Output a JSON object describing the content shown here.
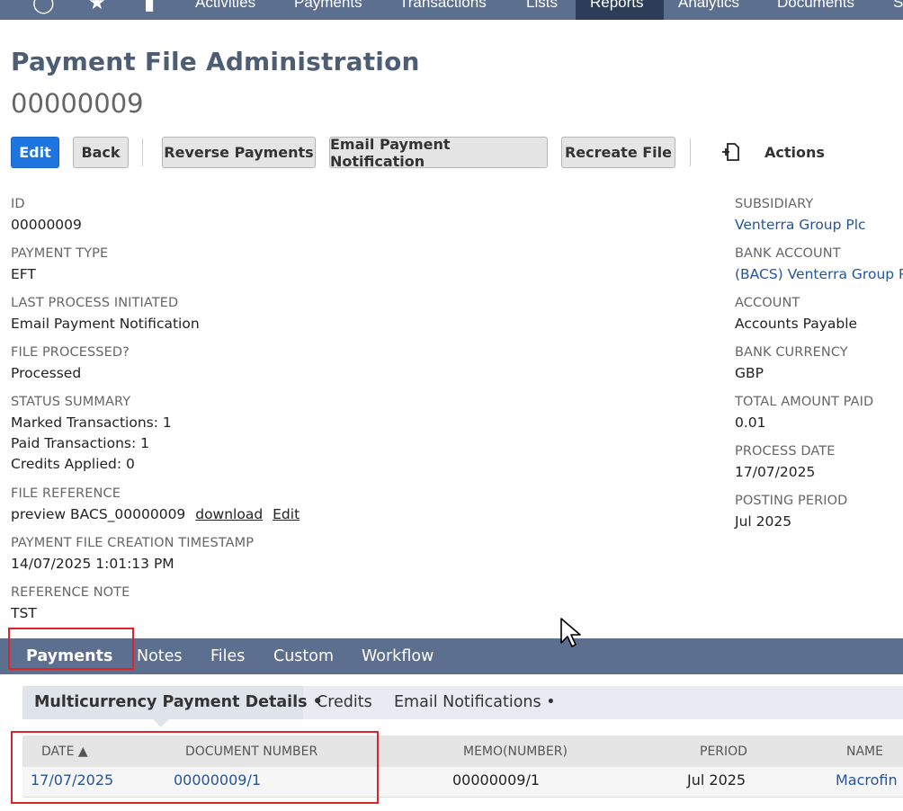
{
  "nav": {
    "items": [
      "Activities",
      "Payments",
      "Transactions",
      "Lists",
      "Reports",
      "Analytics",
      "Documents",
      "S"
    ],
    "active": "Reports"
  },
  "page": {
    "title": "Payment File Administration",
    "record_number": "00000009"
  },
  "toolbar": {
    "edit": "Edit",
    "back": "Back",
    "reverse": "Reverse Payments",
    "email": "Email Payment Notification",
    "recreate": "Recreate File",
    "actions": "Actions"
  },
  "fields_left": {
    "id_label": "ID",
    "id_value": "00000009",
    "payment_type_label": "PAYMENT TYPE",
    "payment_type_value": "EFT",
    "last_process_label": "LAST PROCESS INITIATED",
    "last_process_value": "Email Payment Notification",
    "file_processed_label": "FILE PROCESSED?",
    "file_processed_value": "Processed",
    "status_label": "STATUS SUMMARY",
    "status_line1": "Marked Transactions: 1",
    "status_line2": "Paid Transactions: 1",
    "status_line3": "Credits Applied: 0",
    "file_ref_label": "FILE REFERENCE",
    "file_ref_value": "preview BACS_00000009",
    "file_ref_download": "download",
    "file_ref_edit": "Edit",
    "timestamp_label": "PAYMENT FILE CREATION TIMESTAMP",
    "timestamp_value": "14/07/2025 1:01:13 PM",
    "ref_note_label": "REFERENCE NOTE",
    "ref_note_value": "TST"
  },
  "fields_right": {
    "subsidiary_label": "SUBSIDIARY",
    "subsidiary_value": "Venterra Group Plc",
    "bank_account_label": "BANK ACCOUNT",
    "bank_account_value": "(BACS) Venterra Group P",
    "account_label": "ACCOUNT",
    "account_value": "Accounts Payable",
    "bank_currency_label": "BANK CURRENCY",
    "bank_currency_value": "GBP",
    "total_paid_label": "TOTAL AMOUNT PAID",
    "total_paid_value": "0.01",
    "process_date_label": "PROCESS DATE",
    "process_date_value": "17/07/2025",
    "posting_period_label": "POSTING PERIOD",
    "posting_period_value": "Jul 2025"
  },
  "tabs": {
    "payments": "Payments",
    "notes": "Notes",
    "files": "Files",
    "custom": "Custom",
    "workflow": "Workflow"
  },
  "subtabs": {
    "multicurrency": "Multicurrency Payment Details •",
    "credits": "Credits",
    "email": "Email Notifications •"
  },
  "table": {
    "headers": {
      "date": "DATE ▲",
      "doc_number": "DOCUMENT NUMBER",
      "memo": "MEMO(NUMBER)",
      "period": "PERIOD",
      "name": "NAME"
    },
    "rows": [
      {
        "date": "17/07/2025",
        "doc_number": "00000009/1",
        "memo": "00000009/1",
        "period": "Jul 2025",
        "name": "Macrofin"
      }
    ]
  },
  "colors": {
    "nav_bg": "#5d6f8f",
    "primary_button": "#1f75e0",
    "link": "#255599",
    "highlight": "#d9252b"
  }
}
